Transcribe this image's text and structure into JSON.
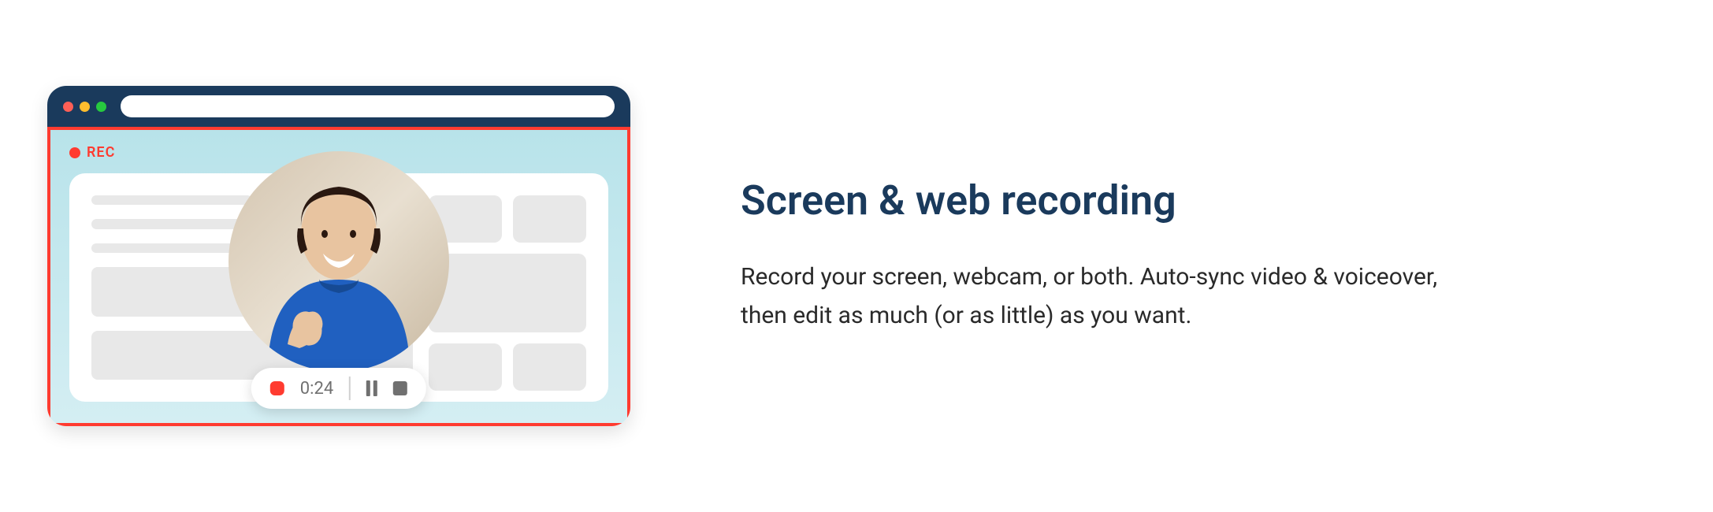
{
  "feature": {
    "heading": "Screen & web recording",
    "description": "Record your screen, webcam, or both. Auto-sync video & voiceover, then edit as much (or as little) as you want."
  },
  "recording": {
    "indicator_label": "REC",
    "elapsed_time": "0:24"
  },
  "colors": {
    "accent_red": "#ff3b30",
    "heading_navy": "#1a3a5c"
  }
}
